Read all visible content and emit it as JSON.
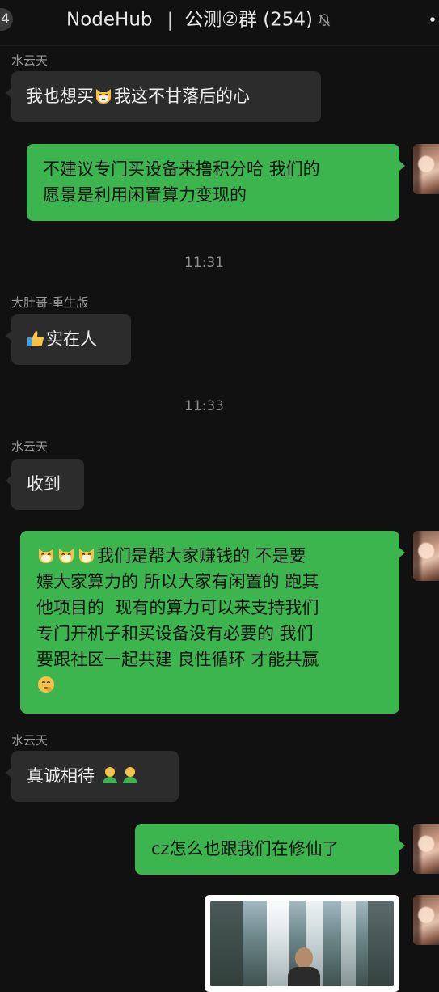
{
  "header": {
    "back_count": "4",
    "app_name": "NodeHub",
    "separator": "|",
    "group_name": "公测②群",
    "member_count": "(254)",
    "mute_icon": "bell-slash-icon",
    "more_icon": "more-dots-icon"
  },
  "messages": [
    {
      "sender": "水云天",
      "text": "我也想买",
      "emoji": "cat-face",
      "text_after": "我这不甘落后的心"
    },
    {
      "text": "不建议专门买设备来撸积分哈 我们的\n愿景是利用闲置算力变现的"
    },
    {
      "time": "11:31"
    },
    {
      "sender": "大肚哥-重生版",
      "emoji": "thumbs-up",
      "text": "实在人"
    },
    {
      "time": "11:33"
    },
    {
      "sender": "水云天",
      "text": "收到"
    },
    {
      "emoji": "cat-face",
      "text": "我们是帮大家赚钱的 不是要\n嫖大家算力的 所以大家有闲置的 跑其\n他项目的  现有的算力可以来支持我们\n专门开机子和买设备没有必要的 我们\n要跟社区一起共建 良性循环 才能共赢",
      "emoji_end": "thinking-face"
    },
    {
      "sender": "水云天",
      "text": "真诚相待",
      "emoji": "person-green"
    },
    {
      "text": "cz怎么也跟我们在修仙了"
    },
    {
      "image": "waterfall-photo"
    }
  ],
  "colors": {
    "background": "#111111",
    "incoming_bubble": "#2c2c2c",
    "outgoing_bubble": "#3cb54f",
    "sender_name": "#9a9a9a"
  }
}
